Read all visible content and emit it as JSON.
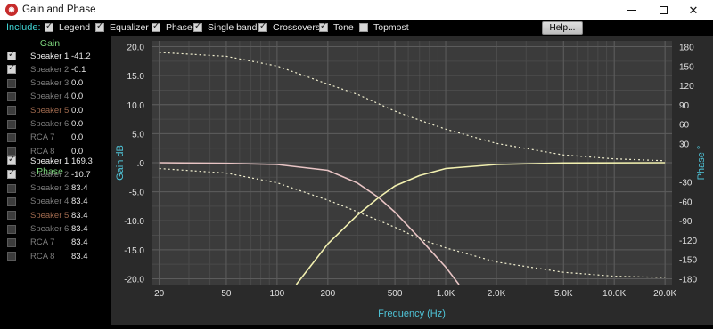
{
  "window": {
    "title": "Gain and Phase",
    "icon": "app-logo-icon",
    "controls": [
      "minimize-icon",
      "maximize-icon",
      "close-icon"
    ]
  },
  "include": {
    "label": "Include:",
    "options": [
      {
        "label": "Legend",
        "checked": true
      },
      {
        "label": "Equalizer",
        "checked": true
      },
      {
        "label": "Phase",
        "checked": true
      },
      {
        "label": "Single band",
        "checked": true
      },
      {
        "label": "Crossovers",
        "checked": true
      },
      {
        "label": "Tone",
        "checked": true
      },
      {
        "label": "Topmost",
        "checked": false
      }
    ],
    "help_label": "Help..."
  },
  "gain": {
    "title": "Gain",
    "rows": [
      {
        "name": "Speaker 1",
        "value": "-41.2",
        "checked": true,
        "style": "active"
      },
      {
        "name": "Speaker 2",
        "value": "-0.1",
        "checked": true,
        "style": "dim"
      },
      {
        "name": "Speaker 3",
        "value": "0.0",
        "checked": false,
        "style": "dim"
      },
      {
        "name": "Speaker 4",
        "value": "0.0",
        "checked": false,
        "style": "dim"
      },
      {
        "name": "Speaker 5",
        "value": "0.0",
        "checked": false,
        "style": "brown"
      },
      {
        "name": "Speaker 6",
        "value": "0.0",
        "checked": false,
        "style": "dim"
      },
      {
        "name": "RCA 7",
        "value": "0.0",
        "checked": false,
        "style": "dim"
      },
      {
        "name": "RCA 8",
        "value": "0.0",
        "checked": false,
        "style": "dim"
      }
    ]
  },
  "phase": {
    "title": "Phase",
    "rows": [
      {
        "name": "Speaker 1",
        "value": "169.3",
        "checked": true,
        "style": "active"
      },
      {
        "name": "Speaker 2",
        "value": "-10.7",
        "checked": true,
        "style": "dim"
      },
      {
        "name": "Speaker 3",
        "value": "83.4",
        "checked": false,
        "style": "dim"
      },
      {
        "name": "Speaker 4",
        "value": "83.4",
        "checked": false,
        "style": "dim"
      },
      {
        "name": "Speaker 5",
        "value": "83.4",
        "checked": false,
        "style": "brown"
      },
      {
        "name": "Speaker 6",
        "value": "83.4",
        "checked": false,
        "style": "dim"
      },
      {
        "name": "RCA 7",
        "value": "83.4",
        "checked": false,
        "style": "dim"
      },
      {
        "name": "RCA 8",
        "value": "83.4",
        "checked": false,
        "style": "dim"
      }
    ]
  },
  "chart_data": {
    "type": "line",
    "xlabel": "Frequency (Hz)",
    "ylabel": "Gain dB",
    "y2label": "Phase °",
    "xscale": "log",
    "xlim": [
      18,
      22000
    ],
    "ylim": [
      -21,
      21
    ],
    "y2lim": [
      -189,
      189
    ],
    "x_ticks": [
      20,
      50,
      100,
      200,
      500,
      1000,
      2000,
      5000,
      10000,
      20000
    ],
    "x_tick_labels": [
      "20",
      "50",
      "100",
      "200",
      "500",
      "1.0K",
      "2.0K",
      "5.0K",
      "10.0K",
      "20.0K"
    ],
    "y_ticks": [
      20,
      15,
      10,
      5,
      0,
      -5,
      -10,
      -15,
      -20
    ],
    "y_tick_labels": [
      "20.0",
      "15.0",
      "10.0",
      "5.0",
      ".0",
      "-5.0",
      "-10.0",
      "-15.0",
      "-20.0"
    ],
    "y2_ticks": [
      180,
      150,
      120,
      90,
      60,
      30,
      -30,
      -60,
      -90,
      -120,
      -150,
      -180
    ],
    "y2_tick_labels": [
      "180",
      "150",
      "120",
      "90",
      "60",
      "30",
      "-30",
      "-60",
      "-90",
      "-120",
      "-150",
      "-180"
    ],
    "grid": true,
    "series": [
      {
        "kind": "gain",
        "color": "#e8c4c4",
        "dashed": false,
        "points": [
          [
            20,
            0
          ],
          [
            50,
            -0.1
          ],
          [
            100,
            -0.3
          ],
          [
            200,
            -1.3
          ],
          [
            300,
            -3.5
          ],
          [
            400,
            -6.0
          ],
          [
            500,
            -8.5
          ],
          [
            700,
            -13.0
          ],
          [
            1000,
            -18.0
          ],
          [
            1200,
            -21.0
          ]
        ]
      },
      {
        "kind": "gain",
        "color": "#f2f0b0",
        "dashed": false,
        "points": [
          [
            130,
            -21.0
          ],
          [
            200,
            -14.0
          ],
          [
            300,
            -9.0
          ],
          [
            400,
            -6.0
          ],
          [
            500,
            -4.0
          ],
          [
            700,
            -2.2
          ],
          [
            1000,
            -1.0
          ],
          [
            2000,
            -0.3
          ],
          [
            5000,
            -0.05
          ],
          [
            20000,
            0
          ]
        ]
      },
      {
        "kind": "phase",
        "color": "#f2f0d0",
        "dashed": true,
        "points": [
          [
            20,
            171
          ],
          [
            50,
            165
          ],
          [
            100,
            150
          ],
          [
            200,
            122
          ],
          [
            300,
            106
          ],
          [
            500,
            80
          ],
          [
            700,
            66
          ],
          [
            1000,
            52
          ],
          [
            2000,
            30
          ],
          [
            5000,
            12
          ],
          [
            10000,
            6
          ],
          [
            20000,
            3
          ]
        ]
      },
      {
        "kind": "phase",
        "color": "#f2f0d0",
        "dashed": true,
        "points": [
          [
            20,
            -9
          ],
          [
            50,
            -16
          ],
          [
            100,
            -31
          ],
          [
            200,
            -58
          ],
          [
            300,
            -76
          ],
          [
            500,
            -100
          ],
          [
            700,
            -118
          ],
          [
            1000,
            -132
          ],
          [
            2000,
            -154
          ],
          [
            5000,
            -170
          ],
          [
            10000,
            -176
          ],
          [
            20000,
            -178
          ]
        ]
      }
    ]
  }
}
